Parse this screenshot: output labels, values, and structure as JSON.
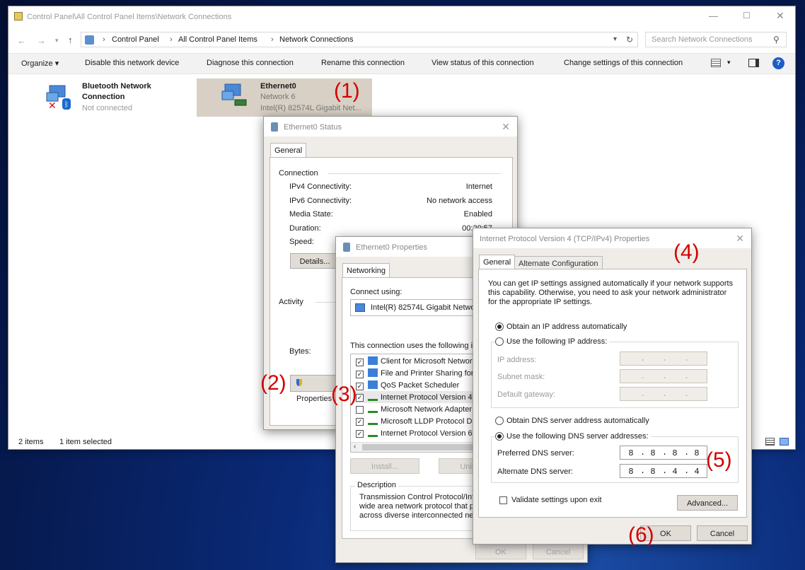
{
  "explorer": {
    "title": "Control Panel\\All Control Panel Items\\Network Connections",
    "breadcrumb": [
      "Control Panel",
      "All Control Panel Items",
      "Network Connections"
    ],
    "search_placeholder": "Search Network Connections",
    "toolbar": [
      "Organize ▾",
      "Disable this network device",
      "Diagnose this connection",
      "Rename this connection",
      "View status of this connection",
      "Change settings of this connection"
    ],
    "items": [
      {
        "name": "Bluetooth Network",
        "name2": "Connection",
        "status": "Not connected"
      },
      {
        "name": "Ethernet0",
        "status": "Network 6",
        "device": "Intel(R) 82574L Gigabit Net..."
      }
    ],
    "status_count": "2 items",
    "status_selected": "1 item selected"
  },
  "status_dialog": {
    "title": "Ethernet0 Status",
    "tab": "General",
    "section_connection": "Connection",
    "rows": [
      {
        "label": "IPv4 Connectivity:",
        "value": "Internet"
      },
      {
        "label": "IPv6 Connectivity:",
        "value": "No network access"
      },
      {
        "label": "Media State:",
        "value": "Enabled"
      },
      {
        "label": "Duration:",
        "value": "00:20:57"
      },
      {
        "label": "Speed:",
        "value": ""
      }
    ],
    "details_button": "Details...",
    "section_activity": "Activity",
    "bytes_label": "Bytes:",
    "properties_button": "Properties"
  },
  "props_dialog": {
    "title": "Ethernet0 Properties",
    "tab": "Networking",
    "connect_using": "Connect using:",
    "adapter": "Intel(R) 82574L Gigabit Network",
    "uses_items": "This connection uses the following ite",
    "components": [
      {
        "label": "Client for Microsoft Networks",
        "checked": true
      },
      {
        "label": "File and Printer Sharing for M",
        "checked": true
      },
      {
        "label": "QoS Packet Scheduler",
        "checked": true
      },
      {
        "label": "Internet Protocol Version 4 (",
        "checked": true
      },
      {
        "label": "Microsoft Network Adapter M",
        "checked": false
      },
      {
        "label": "Microsoft LLDP Protocol Dri",
        "checked": true
      },
      {
        "label": "Internet Protocol Version 6 (",
        "checked": true
      }
    ],
    "install_button": "Install...",
    "uninstall_button": "Uninsta",
    "description_label": "Description",
    "description_lines": [
      "Transmission Control Protocol/Inte",
      "wide area network protocol that pr",
      "across diverse interconnected netw"
    ],
    "ok_button": "OK",
    "cancel_button": "Cancel"
  },
  "ipv4_dialog": {
    "title": "Internet Protocol Version 4 (TCP/IPv4) Properties",
    "tab_general": "General",
    "tab_alternate": "Alternate Configuration",
    "intro_lines": [
      "You can get IP settings assigned automatically if your network supports",
      "this capability. Otherwise, you need to ask your network administrator",
      "for the appropriate IP settings."
    ],
    "radio_auto_ip": "Obtain an IP address automatically",
    "radio_manual_ip": "Use the following IP address:",
    "ip_address": "IP address:",
    "subnet_mask": "Subnet mask:",
    "default_gateway": "Default gateway:",
    "radio_auto_dns": "Obtain DNS server address automatically",
    "radio_manual_dns": "Use the following DNS server addresses:",
    "preferred_dns": "Preferred DNS server:",
    "preferred_dns_value": [
      "8",
      "8",
      "8",
      "8"
    ],
    "alternate_dns": "Alternate DNS server:",
    "alternate_dns_value": [
      "8",
      "8",
      "4",
      "4"
    ],
    "validate_label": "Validate settings upon exit",
    "advanced_button": "Advanced...",
    "ok_button": "OK",
    "cancel_button": "Cancel"
  },
  "annotations": [
    "(1)",
    "(2)",
    "(3)",
    "(4)",
    "(5)",
    "(6)"
  ]
}
